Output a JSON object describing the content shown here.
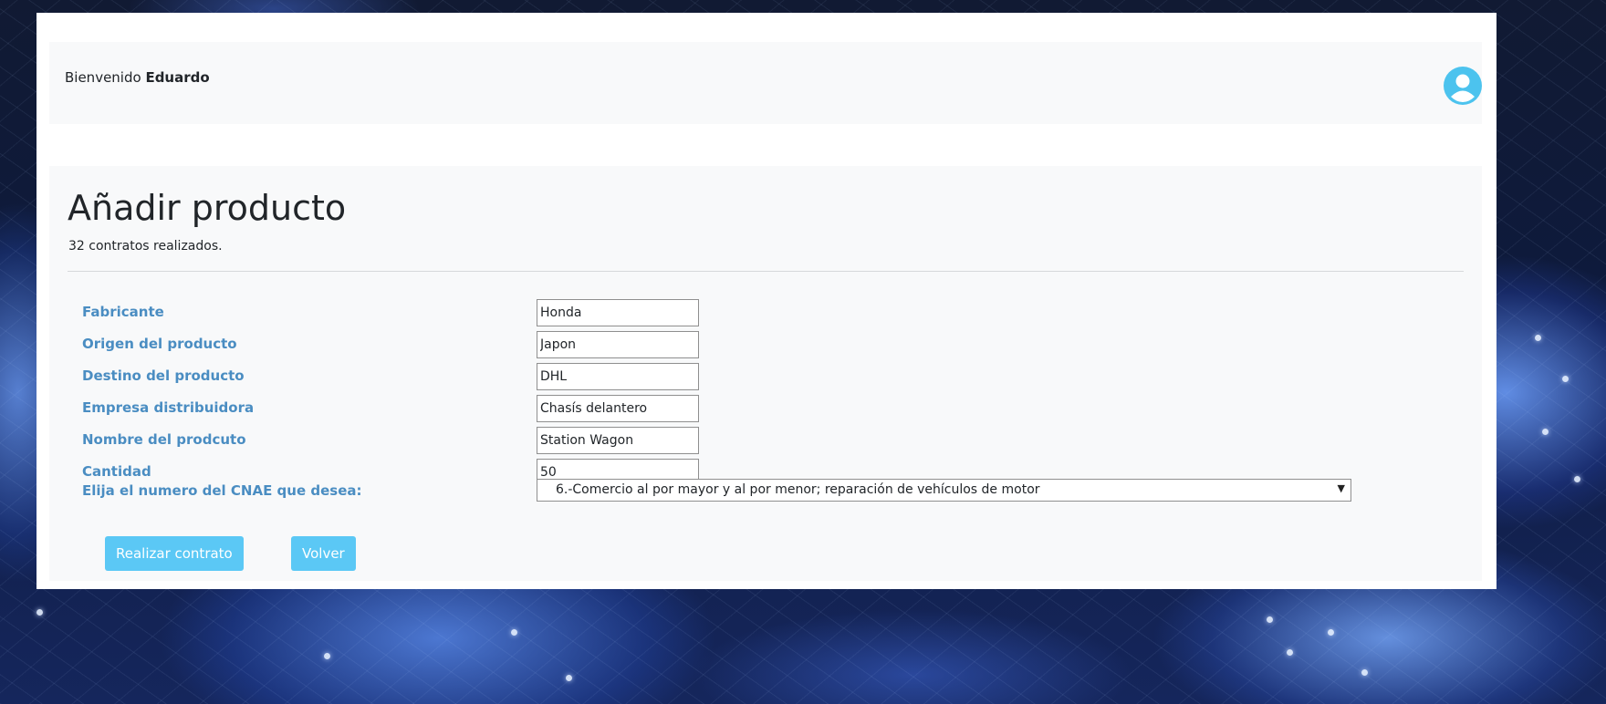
{
  "navbar": {
    "welcome_prefix": "Bienvenido",
    "username": "Eduardo",
    "avatar_icon": "user-circle-icon",
    "avatar_color": "#4cc3ee"
  },
  "main": {
    "title": "Añadir producto",
    "subtitle": "32 contratos realizados.",
    "fields": [
      {
        "label": "Fabricante",
        "value": "Honda"
      },
      {
        "label": "Origen del producto",
        "value": "Japon"
      },
      {
        "label": "Destino del producto",
        "value": "DHL"
      },
      {
        "label": "Empresa distribuidora",
        "value": "Chasís delantero"
      },
      {
        "label": "Nombre del prodcuto",
        "value": "Station Wagon"
      },
      {
        "label": "Cantidad",
        "value": "50"
      }
    ],
    "cnae": {
      "label": "Elija el numero del CNAE que desea:",
      "selected": "6.-Comercio al por mayor y al por menor; reparación de vehículos de motor"
    },
    "buttons": {
      "submit": "Realizar contrato",
      "back": "Volver"
    }
  },
  "colors": {
    "label": "#4a8dc2",
    "button": "#5bc8f5",
    "panel": "#f8f9fa"
  }
}
